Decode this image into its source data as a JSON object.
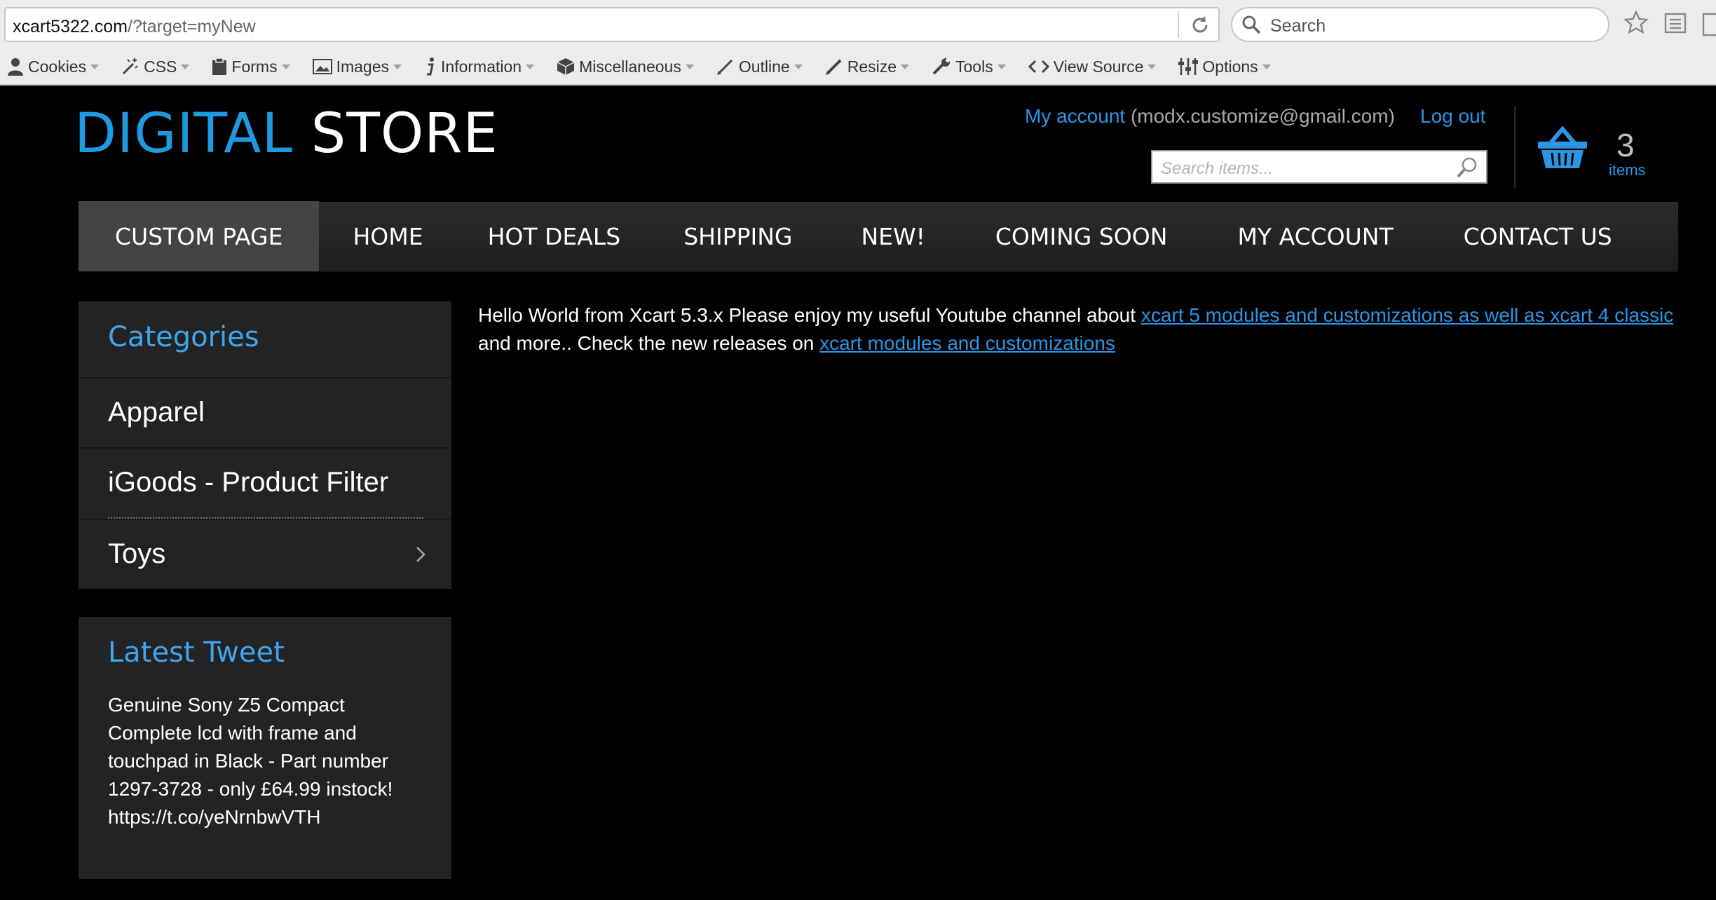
{
  "browser": {
    "url_host": "xcart5322.com",
    "url_path": "/?target=myNew",
    "search_placeholder": "Search"
  },
  "devbar": {
    "items": [
      {
        "label": "Cookies",
        "icon": "person-icon"
      },
      {
        "label": "CSS",
        "icon": "magic-wand-icon"
      },
      {
        "label": "Forms",
        "icon": "clipboard-icon"
      },
      {
        "label": "Images",
        "icon": "image-icon"
      },
      {
        "label": "Information",
        "icon": "info-icon"
      },
      {
        "label": "Miscellaneous",
        "icon": "cube-icon"
      },
      {
        "label": "Outline",
        "icon": "pencil-icon"
      },
      {
        "label": "Resize",
        "icon": "resize-pencil-icon"
      },
      {
        "label": "Tools",
        "icon": "wrench-icon"
      },
      {
        "label": "View Source",
        "icon": "code-icon"
      },
      {
        "label": "Options",
        "icon": "sliders-icon"
      }
    ]
  },
  "header": {
    "logo_part1": "DIGITAL",
    "logo_part2": "STORE",
    "my_account": "My account",
    "account_email": "(modx.customize@gmail.com)",
    "logout": "Log out",
    "search_placeholder": "Search items...",
    "cart_count": "3",
    "cart_items_label": "items"
  },
  "nav": {
    "items": [
      "CUSTOM PAGE",
      "HOME",
      "HOT DEALS",
      "SHIPPING",
      "NEW!",
      "COMING SOON",
      "MY ACCOUNT",
      "CONTACT US"
    ]
  },
  "sidebar": {
    "categories_title": "Categories",
    "categories": [
      "Apparel",
      "iGoods - Product Filter",
      "Toys"
    ],
    "tweet_title": "Latest Tweet",
    "tweet_text": "Genuine Sony Z5 Compact Complete lcd with frame and touchpad in Black - Part number 1297-3728 - only £64.99 instock! https://t.co/yeNrnbwVTH"
  },
  "content": {
    "text1": "Hello World from Xcart 5.3.x Please enjoy my useful Youtube channel about ",
    "link1": "xcart 5 modules and customizations as well as xcart 4 classic",
    "text2": " and more.. Check the new releases on ",
    "link2": "xcart modules and customizations"
  },
  "colors": {
    "accent_blue": "#2c95e6",
    "logo_blue": "#1e9ae0",
    "background": "#000000",
    "panel": "#232323",
    "nav_active": "#444444"
  }
}
